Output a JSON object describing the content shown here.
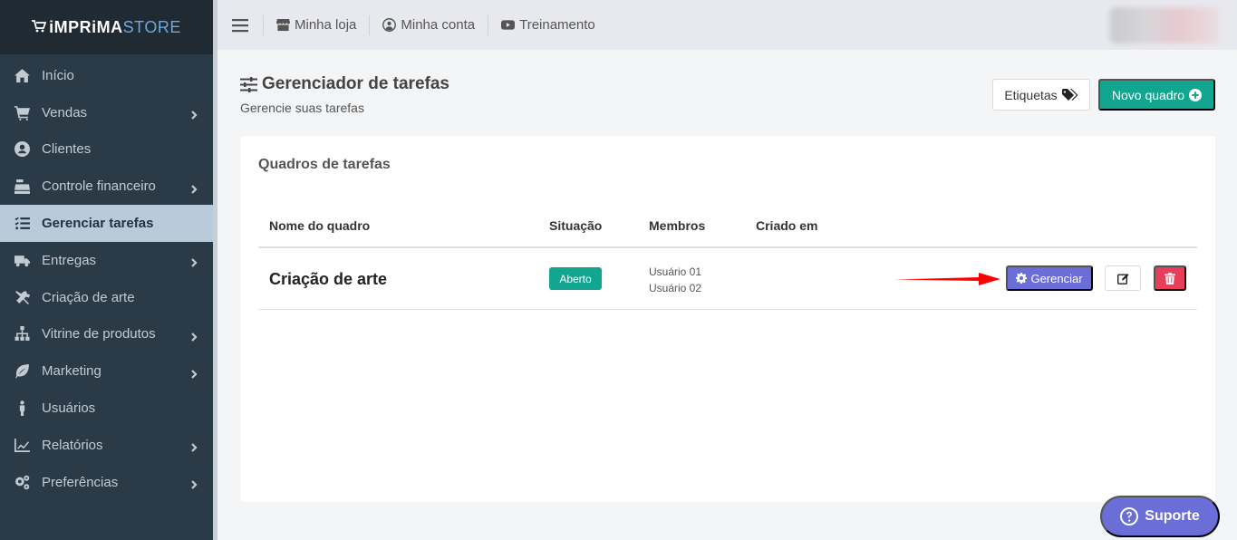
{
  "brand": {
    "part1": "iMPRiMA",
    "part2": "STORE"
  },
  "sidebar": {
    "items": [
      {
        "label": "Início",
        "icon": "home-icon",
        "has_submenu": false,
        "active": false
      },
      {
        "label": "Vendas",
        "icon": "cart-icon",
        "has_submenu": true,
        "active": false
      },
      {
        "label": "Clientes",
        "icon": "user-circle-icon",
        "has_submenu": false,
        "active": false
      },
      {
        "label": "Controle financeiro",
        "icon": "cash-register-icon",
        "has_submenu": true,
        "active": false
      },
      {
        "label": "Gerenciar tarefas",
        "icon": "tasks-icon",
        "has_submenu": false,
        "active": true
      },
      {
        "label": "Entregas",
        "icon": "truck-icon",
        "has_submenu": true,
        "active": false
      },
      {
        "label": "Criação de arte",
        "icon": "tools-icon",
        "has_submenu": false,
        "active": false
      },
      {
        "label": "Vitrine de produtos",
        "icon": "sitemap-icon",
        "has_submenu": true,
        "active": false
      },
      {
        "label": "Marketing",
        "icon": "leaf-icon",
        "has_submenu": true,
        "active": false
      },
      {
        "label": "Usuários",
        "icon": "person-icon",
        "has_submenu": false,
        "active": false
      },
      {
        "label": "Relatórios",
        "icon": "chart-line-icon",
        "has_submenu": true,
        "active": false
      },
      {
        "label": "Preferências",
        "icon": "cogs-icon",
        "has_submenu": true,
        "active": false
      }
    ]
  },
  "topbar": {
    "links": [
      {
        "label": "Minha loja",
        "icon": "store-icon"
      },
      {
        "label": "Minha conta",
        "icon": "account-circle-icon"
      },
      {
        "label": "Treinamento",
        "icon": "youtube-icon"
      }
    ]
  },
  "page": {
    "title": "Gerenciador de tarefas",
    "subtitle": "Gerencie suas tarefas",
    "etiquetas_label": "Etiquetas",
    "novo_quadro_label": "Novo quadro"
  },
  "card": {
    "title": "Quadros de tarefas",
    "columns": [
      "Nome do quadro",
      "Situação",
      "Membros",
      "Criado em"
    ],
    "rows": [
      {
        "name": "Criação de arte",
        "status": "Aberto",
        "members": [
          "Usuário 01",
          "Usuário 02"
        ],
        "created": "",
        "manage_label": "Gerenciar"
      }
    ]
  },
  "support": {
    "label": "Suporte"
  },
  "colors": {
    "sidebar_bg": "#2b3a47",
    "sidebar_active": "#b9cadb",
    "accent_green": "#12a58f",
    "accent_purple": "#6a6ed6",
    "danger": "#e83e5a",
    "arrow_red": "#ff0000"
  }
}
